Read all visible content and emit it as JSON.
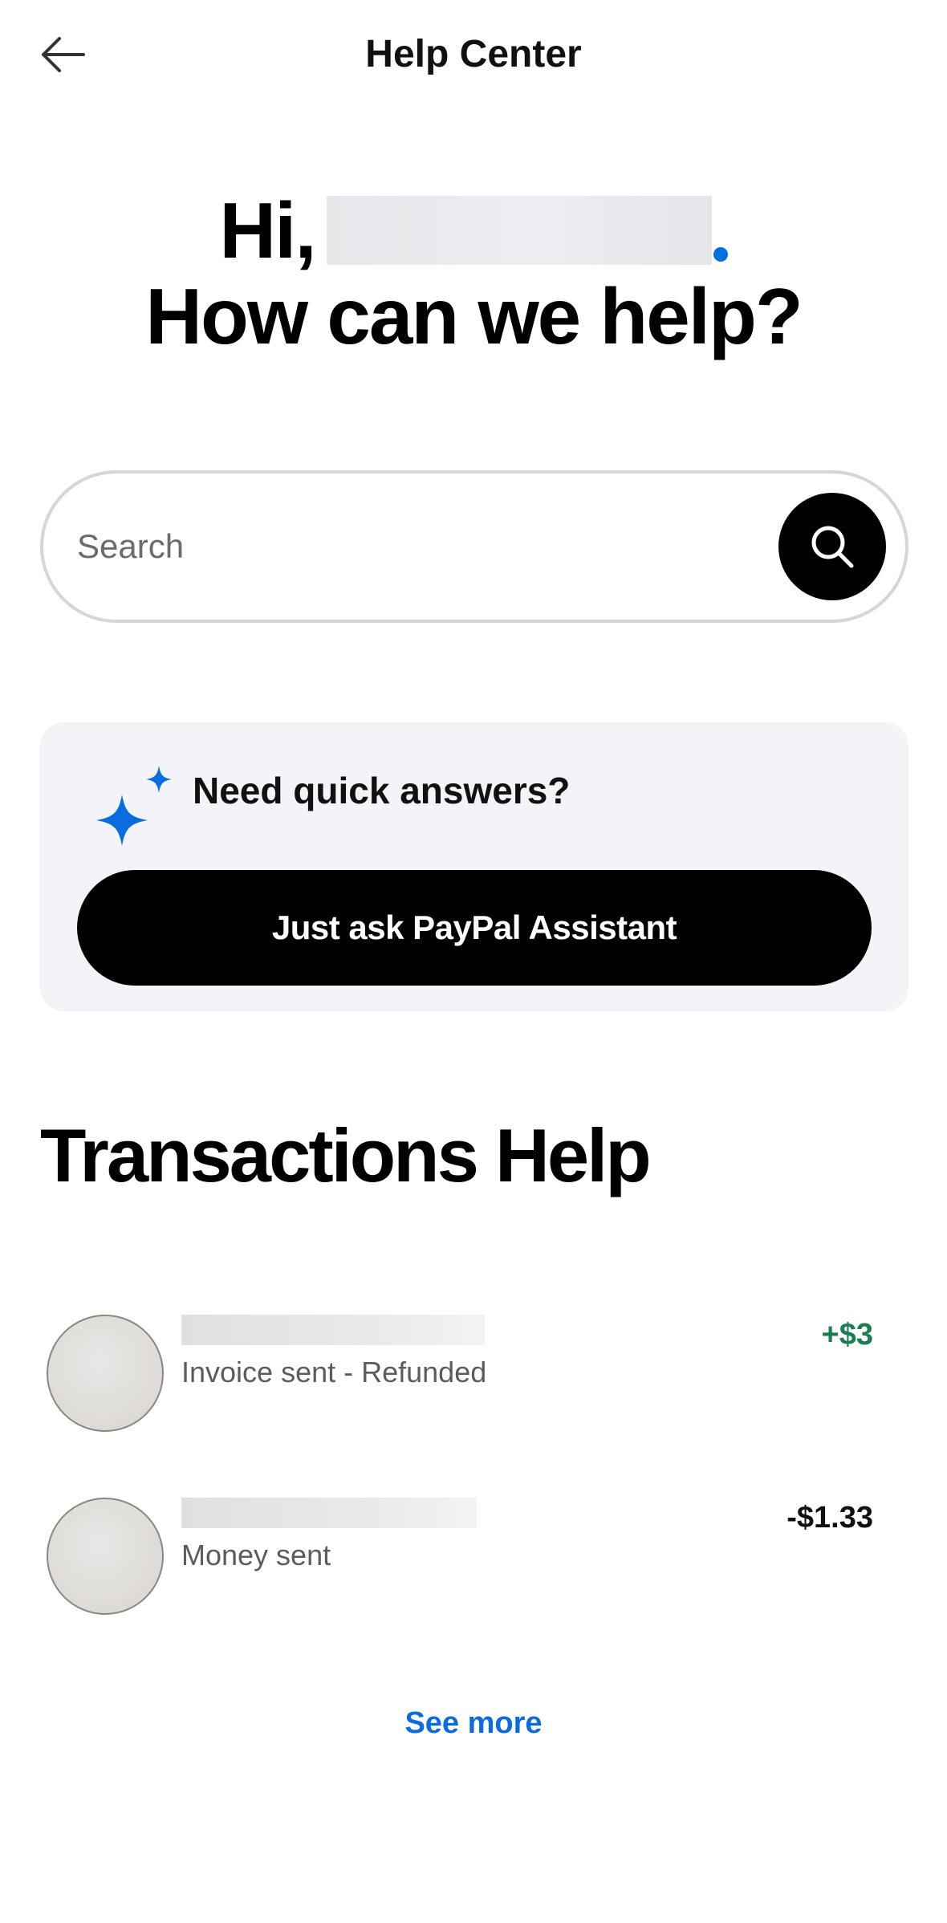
{
  "header": {
    "title": "Help Center",
    "back_icon": "arrow-left-icon"
  },
  "greeting": {
    "hi": "Hi,",
    "question": "How can we help?",
    "accent_color": "#0070e0"
  },
  "search": {
    "placeholder": "Search",
    "icon": "search-icon"
  },
  "assistant": {
    "icon": "sparkle-icon",
    "title": "Need quick answers?",
    "button_label": "Just ask PayPal Assistant",
    "card_color": "#f3f4f8"
  },
  "transactions": {
    "title": "Transactions Help",
    "items": [
      {
        "description": "Invoice sent - Refunded",
        "amount": "+$3",
        "amount_color": "#1a7f4f"
      },
      {
        "description": "Money sent",
        "amount": "-$1.33",
        "amount_color": "#111111"
      }
    ],
    "see_more_label": "See more",
    "link_color": "#0a6cde"
  }
}
